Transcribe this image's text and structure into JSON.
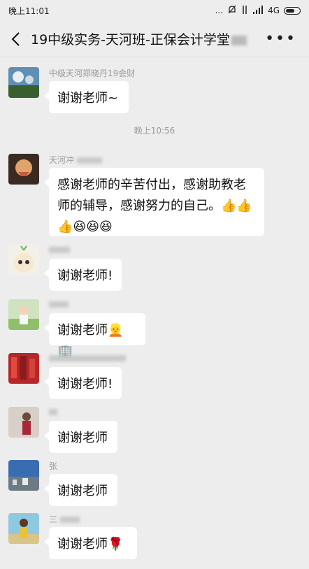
{
  "status_bar": {
    "time": "晚上11:01",
    "dots": "...",
    "network": "4G"
  },
  "header": {
    "title": "19中级实务-天河班-正保会计学堂"
  },
  "chat": {
    "time_separator": "晚上10:56",
    "messages": [
      {
        "sender": "中级天河郑晓丹19会财",
        "text": "谢谢老师~"
      },
      {
        "sender": "天河冲",
        "text_line1": "感谢老师的辛苦付出，感谢助教老",
        "text_line2": "师的辅导，感谢努力的自己。"
      },
      {
        "sender": "",
        "text": "谢谢老师!"
      },
      {
        "sender": "",
        "text": "谢谢老师"
      },
      {
        "sender": "",
        "text": "谢谢老师!"
      },
      {
        "sender": "",
        "text": "谢谢老师"
      },
      {
        "sender": "张",
        "text": "谢谢老师"
      },
      {
        "sender": "三",
        "text": "谢谢老师"
      }
    ]
  },
  "icons": {
    "thumbs_up": "thumbs-up-icon",
    "laughing": "laughing-face-icon",
    "rose": "rose-icon"
  }
}
